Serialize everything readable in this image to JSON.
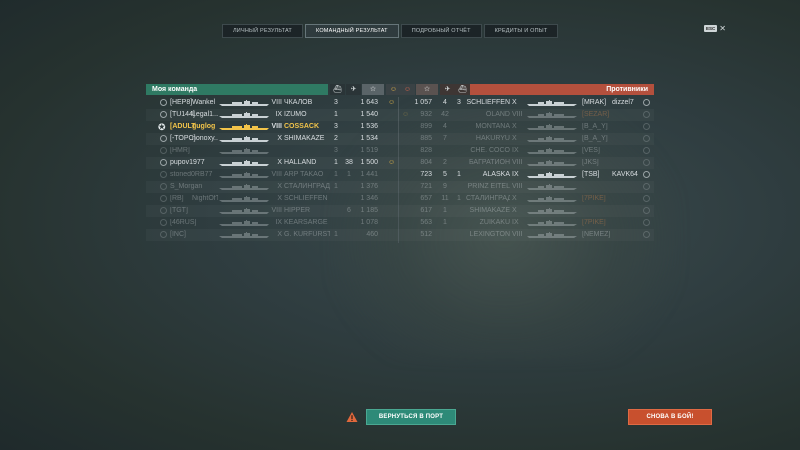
{
  "tabs": [
    {
      "label": "ЛИЧНЫЙ РЕЗУЛЬТАТ",
      "active": false
    },
    {
      "label": "КОМАНДНЫЙ РЕЗУЛЬТАТ",
      "active": true
    },
    {
      "label": "ПОДРОБНЫЙ ОТЧЁТ",
      "active": false
    },
    {
      "label": "КРЕДИТЫ И ОПЫТ",
      "active": false
    }
  ],
  "close": {
    "key_label": "ESC"
  },
  "my_team": {
    "title": "Моя команда",
    "rows": [
      {
        "clan": "[HEP8]",
        "name": "Wankel",
        "tier": "VIII",
        "ship": "ЧКАЛОВ",
        "c1": "3",
        "c2": "",
        "xp": "1 643",
        "icon": "gold",
        "dim": false,
        "me": false
      },
      {
        "clan": "[TU144]",
        "name": "Legal1...",
        "tier": "IX",
        "ship": "IZUMO",
        "c1": "1",
        "c2": "",
        "xp": "1 540",
        "icon": "",
        "dim": false,
        "me": false
      },
      {
        "clan": "[ADULT]",
        "name": "guglog",
        "tier": "VIII",
        "ship": "COSSACK",
        "c1": "3",
        "c2": "",
        "xp": "1 536",
        "icon": "",
        "dim": false,
        "me": true
      },
      {
        "clan": "[-TOPC]",
        "name": "nonoxy...",
        "tier": "X",
        "ship": "SHIMAKAZE",
        "c1": "2",
        "c2": "",
        "xp": "1 534",
        "icon": "",
        "dim": false,
        "me": false
      },
      {
        "clan": "[HMR]",
        "name": "",
        "tier": "",
        "ship": "",
        "c1": "3",
        "c2": "",
        "xp": "1 519",
        "icon": "",
        "dim": true,
        "me": false
      },
      {
        "clan": "",
        "name": "pupov1977",
        "tier": "X",
        "ship": "HALLAND",
        "c1": "1",
        "c2": "38",
        "xp": "1 500",
        "icon": "gold",
        "dim": false,
        "me": false
      },
      {
        "clan": "",
        "name": "stoned0RB77",
        "tier": "VIII",
        "ship": "ARP TAKAO",
        "c1": "1",
        "c2": "1",
        "xp": "1 441",
        "icon": "",
        "dim": true,
        "me": false
      },
      {
        "clan": "",
        "name": "S_Morgan",
        "tier": "X",
        "ship": "СТАЛИНГРАД",
        "c1": "1",
        "c2": "",
        "xp": "1 376",
        "icon": "",
        "dim": true,
        "me": false
      },
      {
        "clan": "[RB]",
        "name": "NightOfThe",
        "tier": "X",
        "ship": "SCHLIEFFEN",
        "c1": "",
        "c2": "",
        "xp": "1 346",
        "icon": "",
        "dim": true,
        "me": false
      },
      {
        "clan": "[TGT]",
        "name": "",
        "tier": "VIII",
        "ship": "HIPPER",
        "c1": "",
        "c2": "6",
        "xp": "1 185",
        "icon": "",
        "dim": true,
        "me": false
      },
      {
        "clan": "[46RUS]",
        "name": "",
        "tier": "IX",
        "ship": "KEARSARGE",
        "c1": "",
        "c2": "",
        "xp": "1 078",
        "icon": "",
        "dim": true,
        "me": false
      },
      {
        "clan": "[INC]",
        "name": "",
        "tier": "X",
        "ship": "G. KURFÜRST",
        "c1": "1",
        "c2": "",
        "xp": "460",
        "icon": "",
        "dim": true,
        "me": false
      }
    ]
  },
  "enemies": {
    "title": "Противники",
    "rows": [
      {
        "xp": "1 057",
        "c1": "4",
        "c2": "3",
        "ship": "SCHLIEFFEN",
        "tier": "X",
        "clan": "[MRAK]",
        "name": "dizzel7",
        "icon": "",
        "dim": false
      },
      {
        "xp": "932",
        "c1": "42",
        "c2": "",
        "ship": "ÖLAND",
        "tier": "VIII",
        "clan": "[SEZAR]",
        "name": "",
        "icon": "gold",
        "dim": true
      },
      {
        "xp": "899",
        "c1": "4",
        "c2": "",
        "ship": "MONTANA",
        "tier": "X",
        "clan": "[B_A_Y]",
        "name": "",
        "icon": "",
        "dim": true
      },
      {
        "xp": "885",
        "c1": "7",
        "c2": "",
        "ship": "HAKURYU",
        "tier": "X",
        "clan": "[B_A_Y]",
        "name": "",
        "icon": "",
        "dim": true
      },
      {
        "xp": "828",
        "c1": "",
        "c2": "",
        "ship": "CHE. COCO",
        "tier": "IX",
        "clan": "[VES]",
        "name": "",
        "icon": "",
        "dim": true
      },
      {
        "xp": "804",
        "c1": "2",
        "c2": "",
        "ship": "БАГРАТИОН",
        "tier": "VIII",
        "clan": "[JKS]",
        "name": "",
        "icon": "",
        "dim": true
      },
      {
        "xp": "723",
        "c1": "5",
        "c2": "1",
        "ship": "ALASKA",
        "tier": "IX",
        "clan": "[TSB]",
        "name": "KAVK64",
        "icon": "",
        "dim": false
      },
      {
        "xp": "721",
        "c1": "9",
        "c2": "",
        "ship": "PRINZ EITEL",
        "tier": "VIII",
        "clan": "",
        "name": "",
        "icon": "",
        "dim": true
      },
      {
        "xp": "657",
        "c1": "11",
        "c2": "1",
        "ship": "СТАЛИНГРАД",
        "tier": "X",
        "clan": "[7PIKE]",
        "name": "",
        "icon": "",
        "dim": true
      },
      {
        "xp": "617",
        "c1": "1",
        "c2": "",
        "ship": "SHIMAKAZE",
        "tier": "X",
        "clan": "",
        "name": "",
        "icon": "",
        "dim": true
      },
      {
        "xp": "563",
        "c1": "1",
        "c2": "",
        "ship": "ZUIKAKU",
        "tier": "IX",
        "clan": "[7PIKE]",
        "name": "",
        "icon": "",
        "dim": true
      },
      {
        "xp": "512",
        "c1": "",
        "c2": "",
        "ship": "LEXINGTON",
        "tier": "VIII",
        "clan": "[NEMEZ]",
        "name": "",
        "icon": "",
        "dim": true
      }
    ]
  },
  "buttons": {
    "back_to_port": "ВЕРНУТЬСЯ В ПОРТ",
    "battle_again": "СНОВА В БОЙ!"
  },
  "colors": {
    "my_team_header": "#2f7a63",
    "enemy_header": "#b4503d",
    "highlight_name": "#f2c44a"
  }
}
